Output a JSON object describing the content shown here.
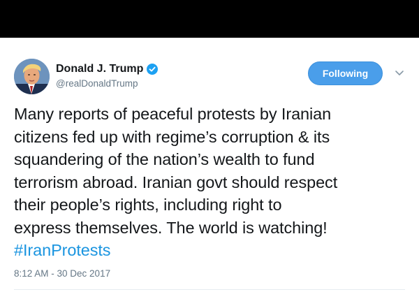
{
  "tweet": {
    "author": {
      "display_name": "Donald J. Trump",
      "handle": "@realDonaldTrump",
      "verified": true,
      "avatar_icon": "profile-photo"
    },
    "follow_button_label": "Following",
    "menu_icon": "chevron-down-icon",
    "text_lines": [
      "Many reports of peaceful protests by Iranian",
      "citizens fed up with regime’s corruption & its",
      "squandering of the nation’s wealth to fund",
      "terrorism abroad. Iranian govt should respect",
      "their people’s rights, including right to",
      "express themselves. The world is watching!"
    ],
    "hashtag": "#IranProtests",
    "timestamp": "8:12 AM - 30 Dec 2017"
  },
  "colors": {
    "top_bar": "#000000",
    "text": "#14171a",
    "secondary_text": "#657786",
    "accent": "#1b95e0",
    "button": "#4a9eea"
  }
}
